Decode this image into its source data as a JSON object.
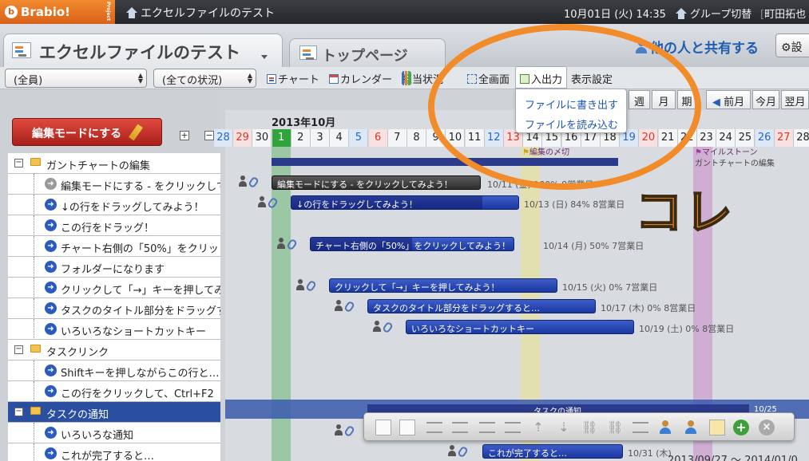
{
  "app": {
    "logo_text": "Brabio!",
    "logo_tag": "Project"
  },
  "topbar": {
    "project_name": "エクセルファイルのテスト",
    "datetime": "10月01日 (火) 14:35",
    "group_switch": "グループ切替",
    "user": "町田拓也"
  },
  "header": {
    "title": "エクセルファイルのテスト",
    "tab_top": "トップページ",
    "share": "他の人と共有する",
    "settings": "設"
  },
  "toolbar": {
    "member_filter": "(全員)",
    "status_filter": "(全ての状況)",
    "chart": "チャート",
    "calendar": "カレンダー",
    "assignee_status": "担当状況",
    "fullscreen": "全画面",
    "io": "入出力",
    "display_settings": "表示設定"
  },
  "io_menu": {
    "export": "ファイルに書き出す",
    "import": "ファイルを読み込む"
  },
  "view_buttons": {
    "week": "週",
    "month": "月",
    "period": "期",
    "prev_month": "前月",
    "this_month": "今月",
    "next_month": "翌月"
  },
  "left": {
    "edit_mode": "編集モードにする",
    "tree": [
      {
        "label": "ガントチャートの編集",
        "kind": "folder",
        "indent": 0
      },
      {
        "label": "編集モードにする - をクリックして",
        "kind": "gray",
        "indent": 1
      },
      {
        "label": "↓の行をドラッグしてみよう！",
        "kind": "task",
        "indent": 1
      },
      {
        "label": "この行をドラッグ！",
        "kind": "task",
        "indent": 1
      },
      {
        "label": "チャート右側の「50%」をクリッ",
        "kind": "task",
        "indent": 1
      },
      {
        "label": "フォルダーになります",
        "kind": "task",
        "indent": 1
      },
      {
        "label": "クリックして「→」キーを押してみ",
        "kind": "task",
        "indent": 1
      },
      {
        "label": "タスクのタイトル部分をドラッグす",
        "kind": "task",
        "indent": 1
      },
      {
        "label": "いろいろなショートカットキー",
        "kind": "task",
        "indent": 1
      },
      {
        "label": "タスクリンク",
        "kind": "folder",
        "indent": 0
      },
      {
        "label": "Shiftキーを押しながらこの行と…",
        "kind": "task",
        "indent": 1
      },
      {
        "label": "この行をクリックして、Ctrl+F2",
        "kind": "task",
        "indent": 1
      },
      {
        "label": "タスクの通知",
        "kind": "folder",
        "indent": 0,
        "selected": true
      },
      {
        "label": "いろいろな通知",
        "kind": "task",
        "indent": 1
      },
      {
        "label": "これが完了すると…",
        "kind": "task",
        "indent": 1
      }
    ]
  },
  "gantt": {
    "month": "2013年10月",
    "days": [
      "28",
      "29",
      "30",
      "1",
      "2",
      "3",
      "4",
      "5",
      "6",
      "7",
      "8",
      "9",
      "10",
      "11",
      "12",
      "13",
      "14",
      "15",
      "16",
      "17",
      "18",
      "19",
      "20",
      "21",
      "22",
      "23",
      "24",
      "25",
      "26",
      "27",
      "28"
    ],
    "milestones": [
      "編集の〆切",
      "マイルストーン"
    ],
    "summaries": [
      "ガントチャートの編集",
      "タスクの通知"
    ],
    "summary_dates": [
      "10/25"
    ],
    "bars": [
      {
        "label": "編集モードにする - をクリックしてみよう！",
        "info": "10/11 (金)   100%  9営業日"
      },
      {
        "label": "↓の行をドラッグしてみよう！",
        "info": "10/13 (日)   84%  8営業日"
      },
      {
        "label": "チャート右側の「50%」をクリックしてみよう！",
        "info": "10/14 (月)   50%  7営業日"
      },
      {
        "label": "クリックして「→」キーを押してみよう！",
        "info": "10/15 (火)   0%  7営業日"
      },
      {
        "label": "タスクのタイトル部分をドラッグすると…",
        "info": "10/17 (木)   0%  8営業日"
      },
      {
        "label": "いろいろなショートカットキー",
        "info": "10/19 (土)   0%  8営業日"
      },
      {
        "label": "これが完了すると…",
        "info": "10/31 (木)"
      }
    ]
  },
  "footer": {
    "date_range": "2013/09/27 ～ 2014/01/0"
  },
  "annotation": {
    "text": "コレ",
    "color": "#f28c2a"
  }
}
